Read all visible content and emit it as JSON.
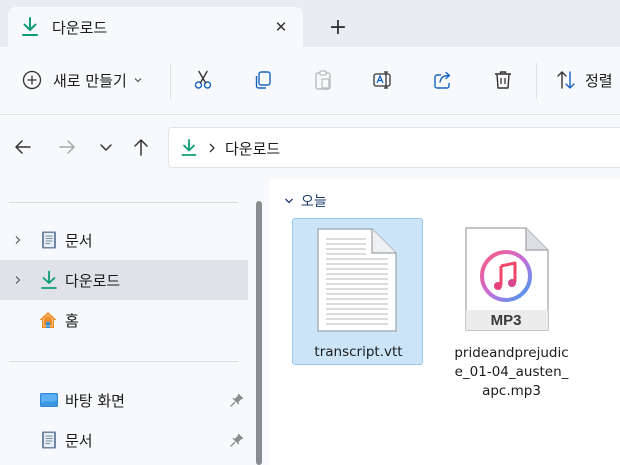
{
  "tab": {
    "title": "다운로드",
    "close_glyph": "✕",
    "new_tab_glyph": "+"
  },
  "toolbar": {
    "new_label": "새로 만들기",
    "sort_label": "정렬",
    "buttons": [
      "cut-icon",
      "copy-icon",
      "paste-icon",
      "rename-icon",
      "share-icon",
      "delete-icon"
    ]
  },
  "address": {
    "location": "다운로드"
  },
  "navigation": {
    "items": [
      {
        "label": "문서",
        "icon": "document-icon",
        "expandable": true,
        "selected": false
      },
      {
        "label": "다운로드",
        "icon": "download-icon",
        "expandable": true,
        "selected": true
      },
      {
        "label": "홈",
        "icon": "home-icon",
        "expandable": false,
        "selected": false
      }
    ],
    "quick_access": [
      {
        "label": "바탕 화면",
        "icon": "desktop-icon",
        "pinned": true
      },
      {
        "label": "문서",
        "icon": "document-icon",
        "pinned": true
      }
    ]
  },
  "content": {
    "group_label": "오늘",
    "files": [
      {
        "name": "transcript.vtt",
        "type": "text-file-icon",
        "selected": true
      },
      {
        "name": "prideandprejudice_01-04_austen_apc.mp3",
        "name_lines": [
          "prideandprejudic",
          "e_01-04_austen_",
          "apc.mp3"
        ],
        "type": "mp3-file-icon",
        "badge": "MP3",
        "selected": false
      }
    ]
  },
  "colors": {
    "accent": "#0f9d76",
    "selection": "#cce4f7",
    "nav_selected": "#dfe3e8",
    "chrome": "#f7f9fc"
  }
}
